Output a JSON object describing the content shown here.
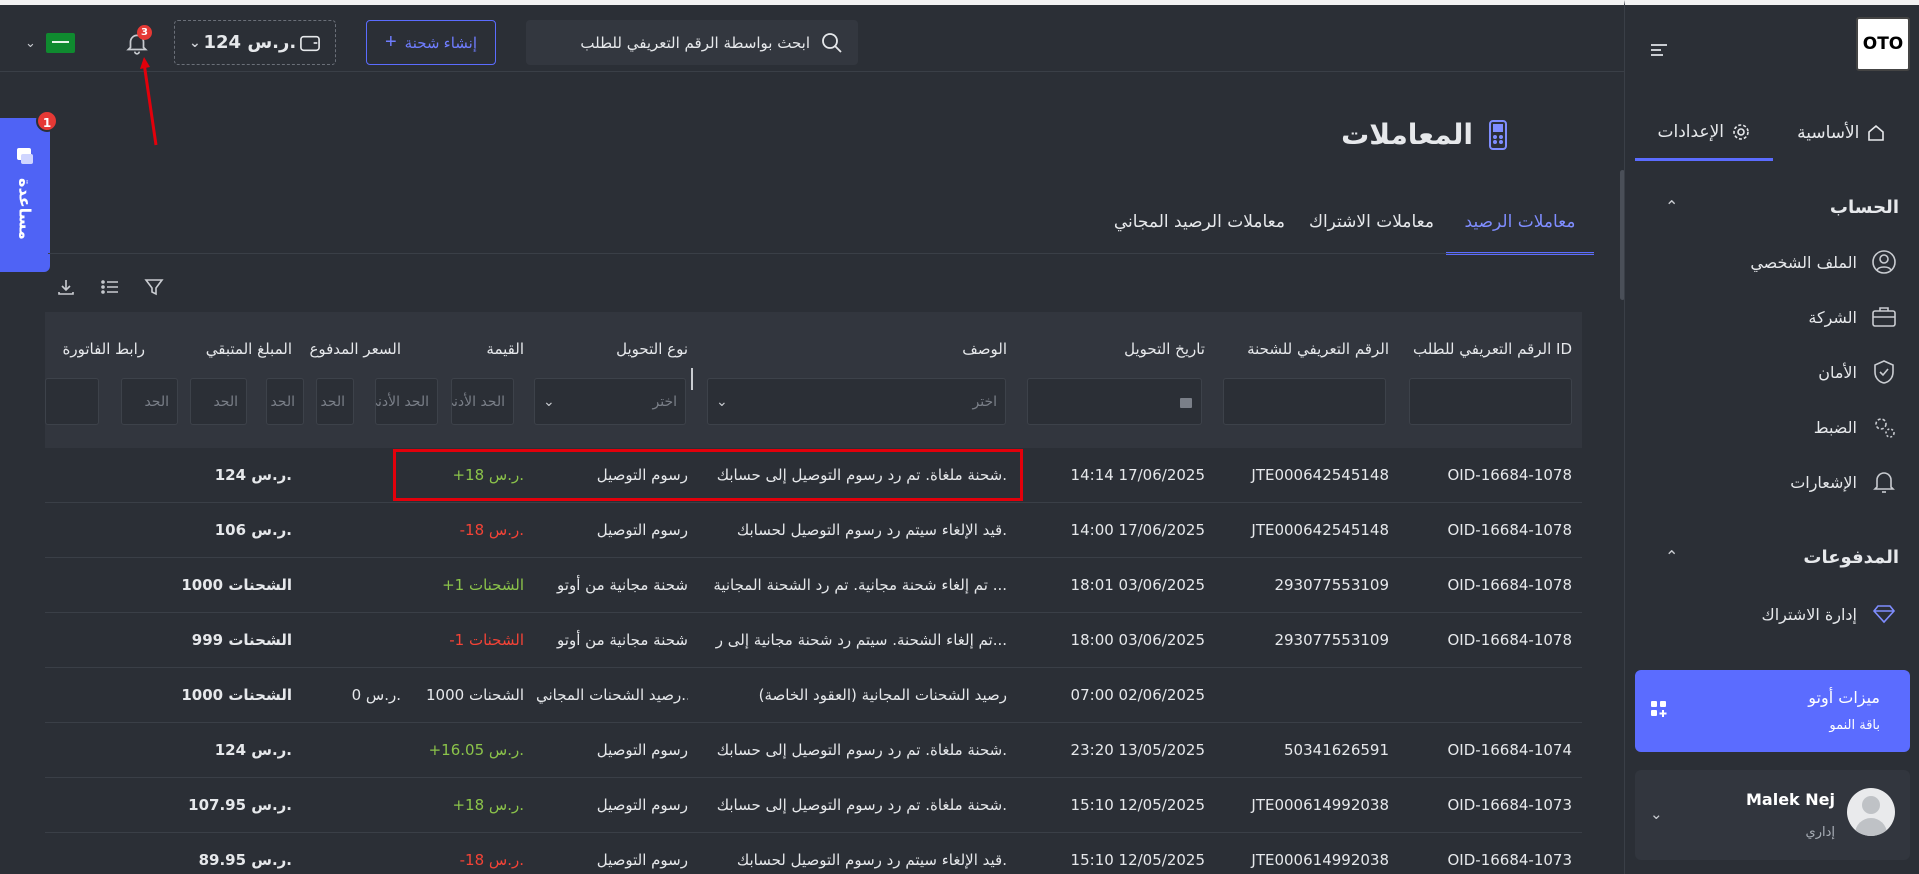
{
  "header": {
    "currency_selector_chevron": "chevron-down",
    "notifications_count": "3",
    "wallet_balance": "124 ر.س.",
    "create_shipment_label": "إنشاء شحنة",
    "search_placeholder": "ابحث بواسطة الرقم التعريفي للطلب"
  },
  "help": {
    "label": "مساعدة",
    "badge": "1"
  },
  "page": {
    "title": "المعاملات",
    "tabs": [
      "معاملات الرصيد",
      "معاملات الاشتراك",
      "معاملات الرصيد المجاني"
    ],
    "active_tab": "معاملات الرصيد"
  },
  "table": {
    "columns": {
      "order_id": "الرقم التعريفي للطلب ID",
      "shipment_id": "الرقم التعريفي للشحنة",
      "date": "تاريخ التحويل",
      "description": "الوصف",
      "type": "نوع التحويل",
      "value": "القيمة",
      "paid_price": "السعر المدفوع",
      "remaining": "المبلغ المتبقي",
      "invoice_link": "رابط الفاتورة"
    },
    "filters": {
      "select_placeholder": "اختر",
      "min_placeholder": "الحد الأدنى",
      "min_short": "الحد"
    },
    "rows": [
      {
        "order_id": "OID-16684-1078",
        "shipment_id": "JTE000642545148",
        "date": "14:14 17/06/2025",
        "description": "شحنة ملغاة. تم رد رسوم التوصيل إلى حسابك.",
        "type": "رسوم التوصيل",
        "value": "+18 ر.س.",
        "value_status": "positive",
        "paid_price": "",
        "remaining": "124 ر.س."
      },
      {
        "order_id": "OID-16684-1078",
        "shipment_id": "JTE000642545148",
        "date": "14:00 17/06/2025",
        "description": "قيد الإلغاء سيتم رد رسوم التوصيل لحسابك.",
        "type": "رسوم التوصيل",
        "value": "-18 ر.س.",
        "value_status": "negative",
        "paid_price": "",
        "remaining": "106 ر.س."
      },
      {
        "order_id": "OID-16684-1078",
        "shipment_id": "293077553109",
        "date": "18:01 03/06/2025",
        "description": "تم إلغاء شحنة مجانية. تم رد الشحنة المجانية ...",
        "type": "شحنة مجانية من أوتو",
        "value": "+1 الشحنات",
        "value_status": "positive",
        "paid_price": "",
        "remaining": "1000 الشحنات"
      },
      {
        "order_id": "OID-16684-1078",
        "shipment_id": "293077553109",
        "date": "18:00 03/06/2025",
        "description": "تم إلغاء الشحنة. سيتم رد شحنة مجانية إلى ر...",
        "type": "شحنة مجانية من أوتو",
        "value": "-1 الشحنات",
        "value_status": "negative",
        "paid_price": "",
        "remaining": "999 الشحنات"
      },
      {
        "order_id": "",
        "shipment_id": "",
        "date": "07:00 02/06/2025",
        "description": "رصيد الشحنات المجانية (العقود الخاصة)",
        "type": "رصيد الشحنات المجاني...",
        "value": "1000 الشحنات",
        "value_status": "neutral",
        "paid_price": "0 ر.س.",
        "remaining": "1000 الشحنات"
      },
      {
        "order_id": "OID-16684-1074",
        "shipment_id": "50341626591",
        "date": "23:20 13/05/2025",
        "description": "شحنة ملغاة. تم رد رسوم التوصيل إلى حسابك.",
        "type": "رسوم التوصيل",
        "value": "+16.05 ر.س.",
        "value_status": "positive",
        "paid_price": "",
        "remaining": "124 ر.س."
      },
      {
        "order_id": "OID-16684-1073",
        "shipment_id": "JTE000614992038",
        "date": "15:10 12/05/2025",
        "description": "شحنة ملغاة. تم رد رسوم التوصيل إلى حسابك.",
        "type": "رسوم التوصيل",
        "value": "+18 ر.س.",
        "value_status": "positive",
        "paid_price": "",
        "remaining": "107.95 ر.س."
      },
      {
        "order_id": "OID-16684-1073",
        "shipment_id": "JTE000614992038",
        "date": "15:10 12/05/2025",
        "description": "قيد الإلغاء سيتم رد رسوم التوصيل لحسابك.",
        "type": "رسوم التوصيل",
        "value": "-18 ر.س.",
        "value_status": "negative",
        "paid_price": "",
        "remaining": "89.95 ر.س."
      }
    ]
  },
  "sidebar": {
    "logo": "OTO",
    "tabs": [
      "الأساسية",
      "الإعدادات"
    ],
    "active_tab": "الإعدادات",
    "account_title": "الحساب",
    "account_items": [
      "الملف الشخصي",
      "الشركة",
      "الأمان",
      "الضبط",
      "الإشعارات"
    ],
    "payments_title": "المدفوعات",
    "payments_items": [
      "إدارة الاشتراك"
    ],
    "promo": {
      "title": "ميزات أوتو",
      "subtitle": "باقة النمو"
    },
    "user": {
      "name": "Malek Nej",
      "role": "إداري"
    }
  },
  "colors": {
    "accent": "#5b6cff",
    "positive": "#8bc34a",
    "negative": "#f44336",
    "highlight_box": "#e3000b"
  }
}
